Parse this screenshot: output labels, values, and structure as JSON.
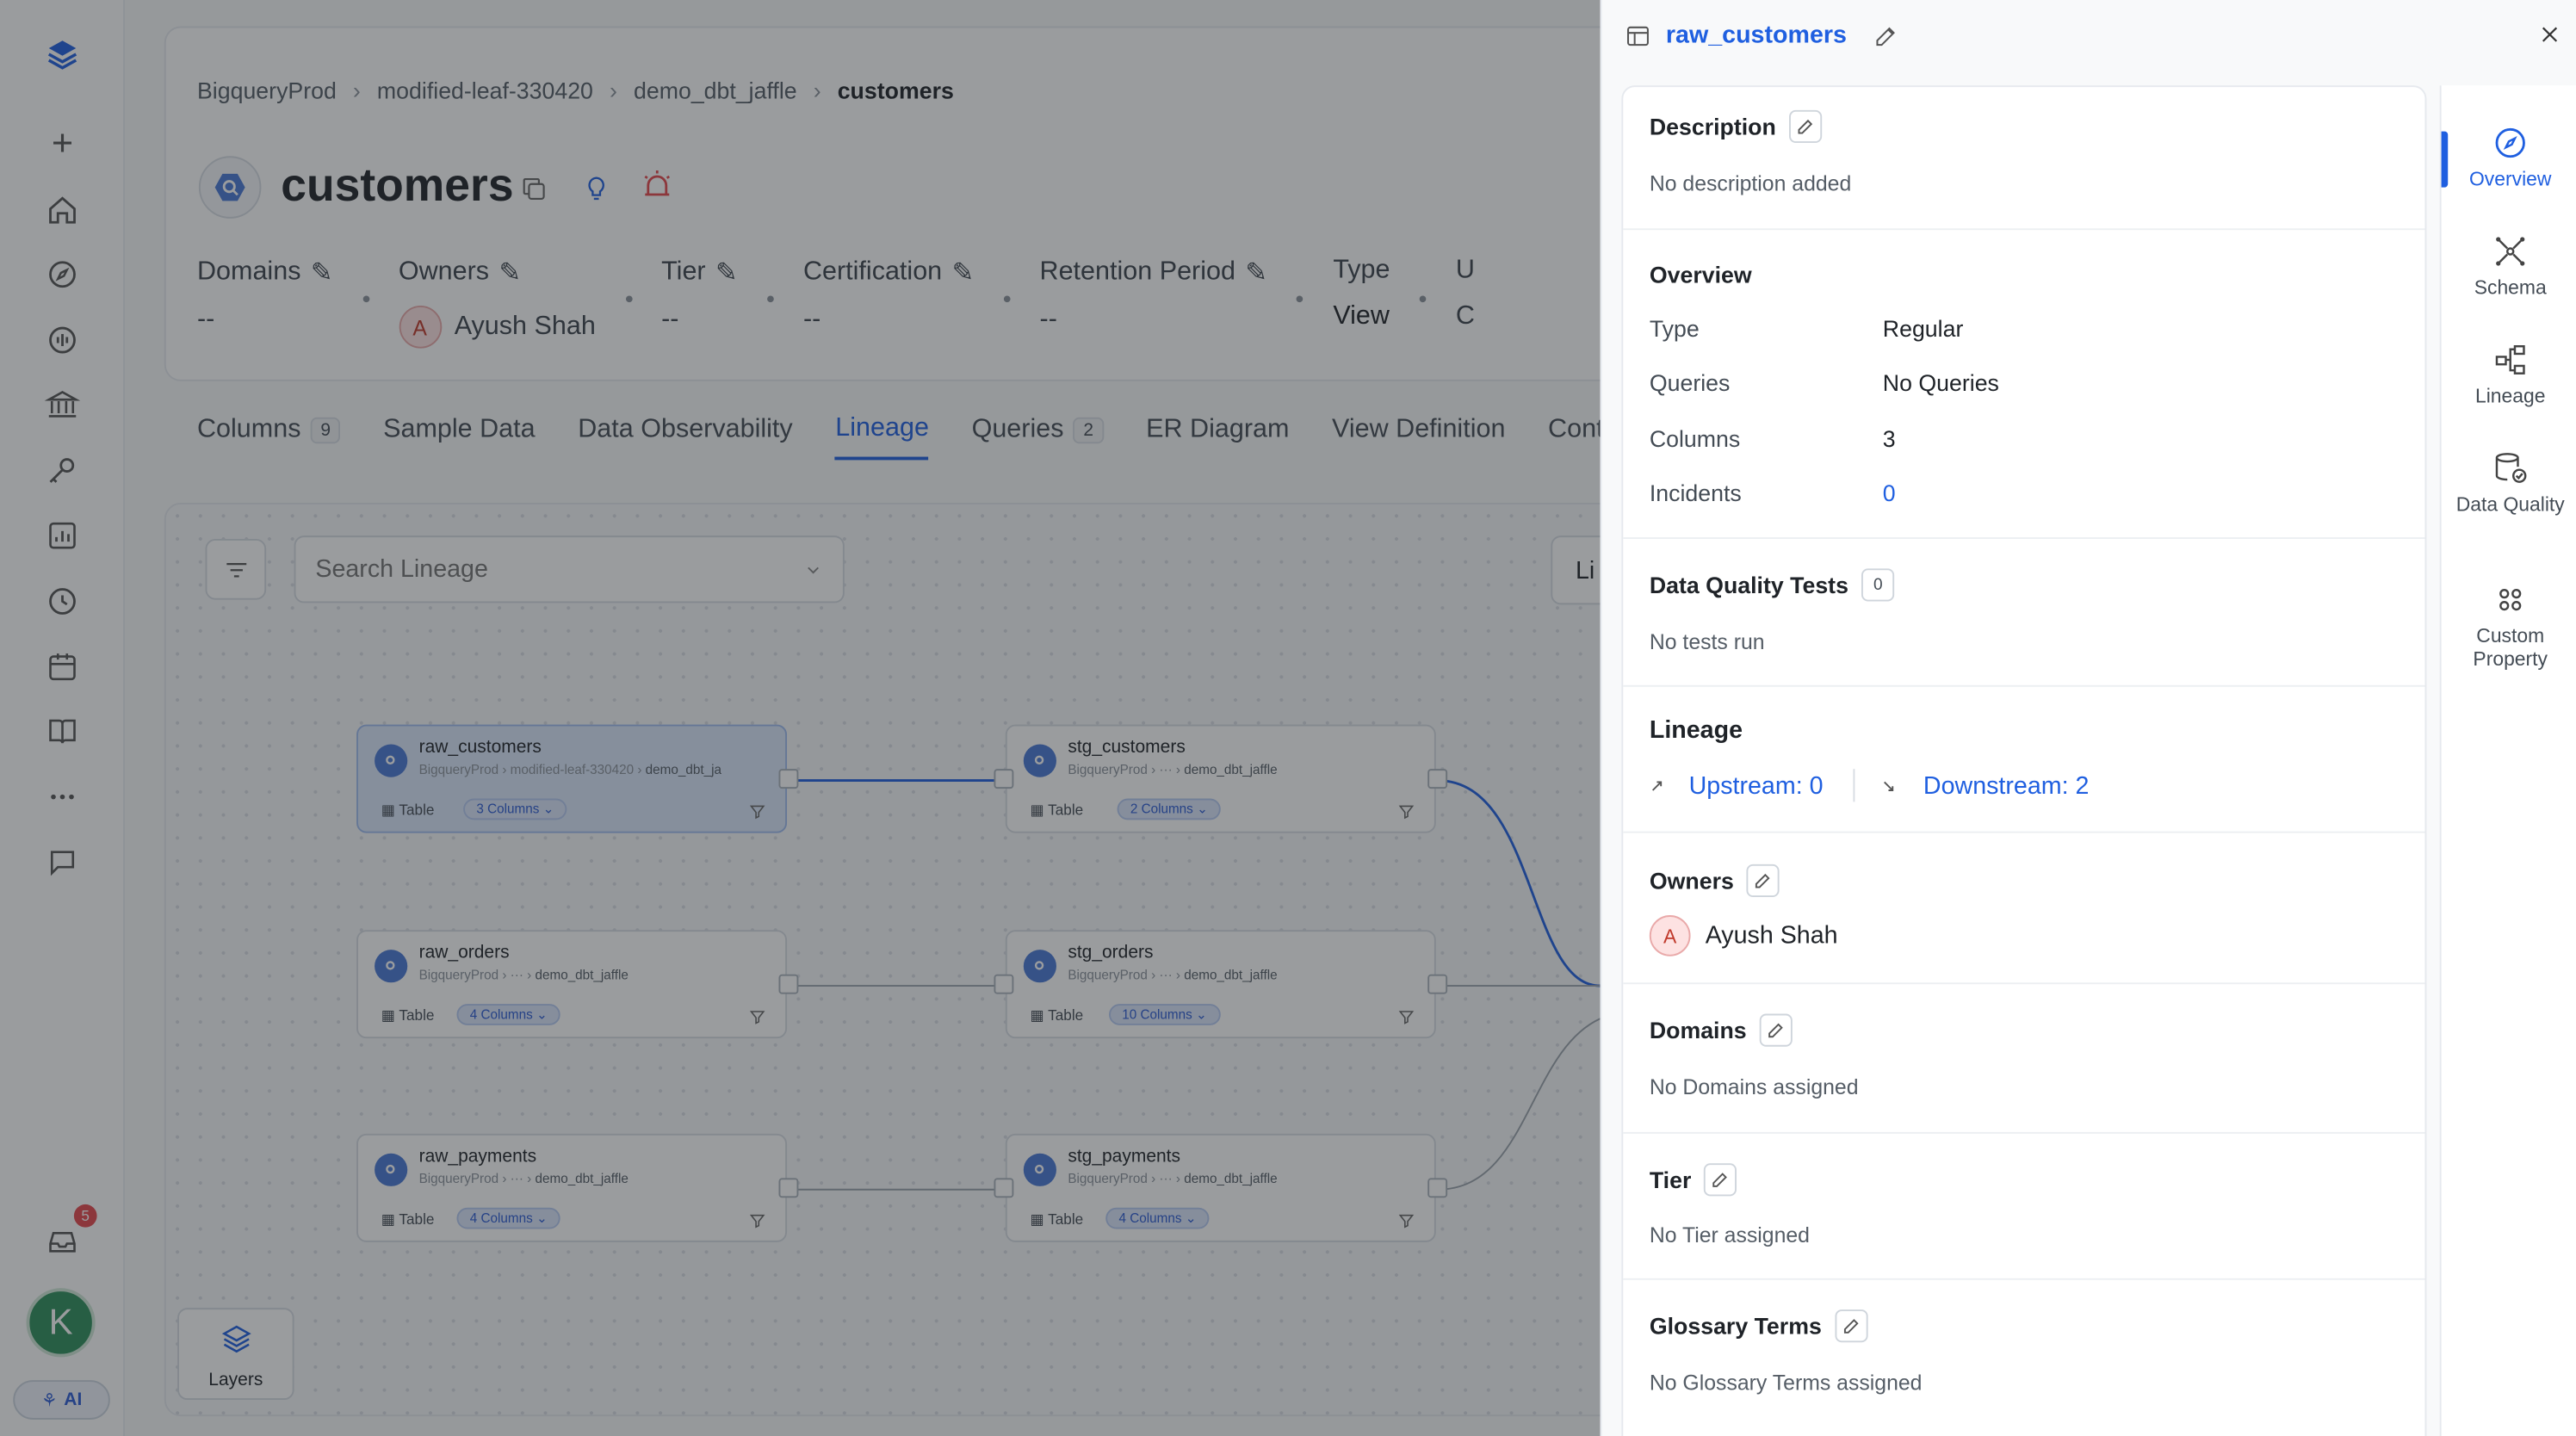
{
  "breadcrumb": [
    "BigqueryProd",
    "modified-leaf-330420",
    "demo_dbt_jaffle",
    "customers"
  ],
  "entity": {
    "name": "customers",
    "properties": [
      {
        "label": "Domains",
        "value": "--"
      },
      {
        "label": "Owners",
        "value": "Ayush Shah",
        "avatar": "A"
      },
      {
        "label": "Tier",
        "value": "--"
      },
      {
        "label": "Certification",
        "value": "--"
      },
      {
        "label": "Retention Period",
        "value": "--"
      },
      {
        "label": "Type",
        "value": "View"
      },
      {
        "label": "U",
        "value": "C"
      }
    ]
  },
  "tabs": [
    {
      "label": "Columns",
      "count": "9"
    },
    {
      "label": "Sample Data"
    },
    {
      "label": "Data Observability"
    },
    {
      "label": "Lineage",
      "active": true
    },
    {
      "label": "Queries",
      "count": "2"
    },
    {
      "label": "ER Diagram"
    },
    {
      "label": "View Definition"
    },
    {
      "label": "Contra"
    }
  ],
  "lineage": {
    "search_placeholder": "Search Lineage",
    "top_right_button": "Li",
    "layers_label": "Layers",
    "nodes": [
      {
        "name": "raw_customers",
        "path": [
          "BigqueryProd",
          "modified-leaf-330420",
          "demo_dbt_ja"
        ],
        "type": "Table",
        "columns": "3 Columns",
        "selected": true
      },
      {
        "name": "stg_customers",
        "path": [
          "BigqueryProd",
          "···",
          "demo_dbt_jaffle"
        ],
        "type": "Table",
        "columns": "2 Columns"
      },
      {
        "name": "raw_orders",
        "path": [
          "BigqueryProd",
          "···",
          "demo_dbt_jaffle"
        ],
        "type": "Table",
        "columns": "4 Columns"
      },
      {
        "name": "stg_orders",
        "path": [
          "BigqueryProd",
          "···",
          "demo_dbt_jaffle"
        ],
        "type": "Table",
        "columns": "10 Columns"
      },
      {
        "name": "raw_payments",
        "path": [
          "BigqueryProd",
          "···",
          "demo_dbt_jaffle"
        ],
        "type": "Table",
        "columns": "4 Columns"
      },
      {
        "name": "stg_payments",
        "path": [
          "BigqueryProd",
          "···",
          "demo_dbt_jaffle"
        ],
        "type": "Table",
        "columns": "4 Columns"
      }
    ]
  },
  "nav": {
    "notification_count": "5",
    "user_initial": "K",
    "ai_label": "AI"
  },
  "drawer": {
    "title": "raw_customers",
    "description": {
      "title": "Description",
      "text": "No description added"
    },
    "overview": {
      "title": "Overview",
      "rows": [
        {
          "key": "Type",
          "value": "Regular"
        },
        {
          "key": "Queries",
          "value": "No Queries"
        },
        {
          "key": "Columns",
          "value": "3"
        },
        {
          "key": "Incidents",
          "value": "0"
        }
      ]
    },
    "dq_tests": {
      "title": "Data Quality Tests",
      "count": "0",
      "text": "No tests run"
    },
    "lineage": {
      "title": "Lineage",
      "upstream": "Upstream: 0",
      "downstream": "Downstream: 2"
    },
    "owners": {
      "title": "Owners",
      "name": "Ayush Shah",
      "initial": "A"
    },
    "domains": {
      "title": "Domains",
      "text": "No Domains assigned"
    },
    "tier": {
      "title": "Tier",
      "text": "No Tier assigned"
    },
    "glossary": {
      "title": "Glossary Terms",
      "text": "No Glossary Terms assigned"
    },
    "rail": [
      {
        "label": "Overview",
        "icon": "compass-icon",
        "active": true
      },
      {
        "label": "Schema",
        "icon": "schema-icon"
      },
      {
        "label": "Lineage",
        "icon": "lineage-icon"
      },
      {
        "label": "Data Quality",
        "icon": "data-quality-icon"
      },
      {
        "label": "Custom Property",
        "icon": "custom-property-icon"
      }
    ]
  },
  "colors": {
    "accent": "#1f5fe0",
    "overlay": "rgba(31,35,40,0.45)",
    "badge": "#e5484d"
  }
}
